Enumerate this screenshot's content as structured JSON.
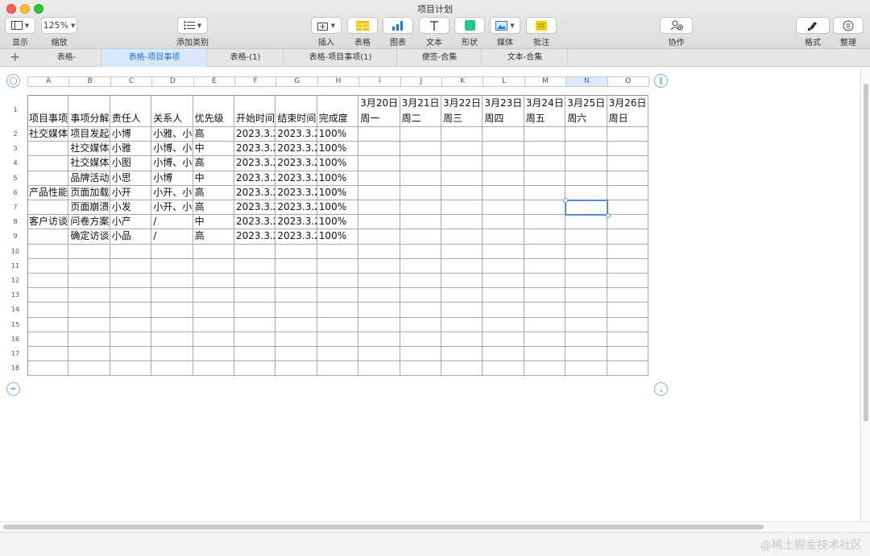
{
  "window": {
    "title": "项目计划"
  },
  "toolbar": {
    "view_label": "显示",
    "zoom_value": "125%",
    "zoom_label": "缩放",
    "add_category_label": "添加类别",
    "insert_label": "插入",
    "table_label": "表格",
    "chart_label": "图表",
    "text_label": "文本",
    "shape_label": "形状",
    "media_label": "媒体",
    "comment_label": "批注",
    "collaborate_label": "协作",
    "format_label": "格式",
    "organize_label": "整理",
    "colors": {
      "table_icon": "#f5c400",
      "chart_icon": "#1a7be0",
      "shape_icon": "#1fc789",
      "comment_icon": "#f5d000"
    }
  },
  "tabs": [
    {
      "label": "表格-"
    },
    {
      "label": "表格-项目事项",
      "active": true
    },
    {
      "label": "表格-(1)"
    },
    {
      "label": "表格-项目事项(1)"
    },
    {
      "label": "便签-合集"
    },
    {
      "label": "文本-合集"
    }
  ],
  "sheet": {
    "columns": [
      "A",
      "B",
      "C",
      "D",
      "E",
      "F",
      "G",
      "H",
      "I",
      "J",
      "K",
      "L",
      "M",
      "N",
      "O"
    ],
    "selected_column": "N",
    "selected_row": "7",
    "header_cells": [
      "项目事项",
      "事项分解",
      "责任人",
      "关系人",
      "优先级",
      "开始时间",
      "结束时间",
      "完成度",
      "3月20日 周一",
      "3月21日 周二",
      "3月22日 周三",
      "3月23日 周四",
      "3月24日 周五",
      "3月25日 周六",
      "3月26日 周日"
    ],
    "rows": [
      [
        "社交媒体",
        "项目发起",
        "小博",
        "小雅、小",
        "高",
        "2023.3.2",
        "2023.3.2",
        "100%"
      ],
      [
        "",
        "社交媒体",
        "小雅",
        "小博、小",
        "中",
        "2023.3.2",
        "2023.3.2",
        "100%"
      ],
      [
        "",
        "社交媒体",
        "小图",
        "小博、小",
        "高",
        "2023.3.2",
        "2023.3.2",
        "100%"
      ],
      [
        "",
        "品牌活动",
        "小思",
        "小博",
        "中",
        "2023.3.2",
        "2023.3.2",
        "100%"
      ],
      [
        "产品性能",
        "页面加载",
        "小开",
        "小开、小",
        "高",
        "2023.3.2",
        "2023.3.2",
        "100%"
      ],
      [
        "",
        "页面崩溃",
        "小发",
        "小开、小",
        "高",
        "2023.3.2",
        "2023.3.2",
        "100%"
      ],
      [
        "客户访谈",
        "问卷方案",
        "小产",
        "/",
        "中",
        "2023.3.2",
        "2023.3.2",
        "100%"
      ],
      [
        "",
        "确定访谈",
        "小品",
        "/",
        "高",
        "2023.3.2",
        "2023.3.2",
        "100%"
      ]
    ],
    "row_numbers": [
      "1",
      "2",
      "3",
      "4",
      "5",
      "6",
      "7",
      "8",
      "9",
      "10",
      "11",
      "12",
      "13",
      "14",
      "15",
      "16",
      "17",
      "18"
    ]
  },
  "watermark": "@稀土掘金技术社区"
}
